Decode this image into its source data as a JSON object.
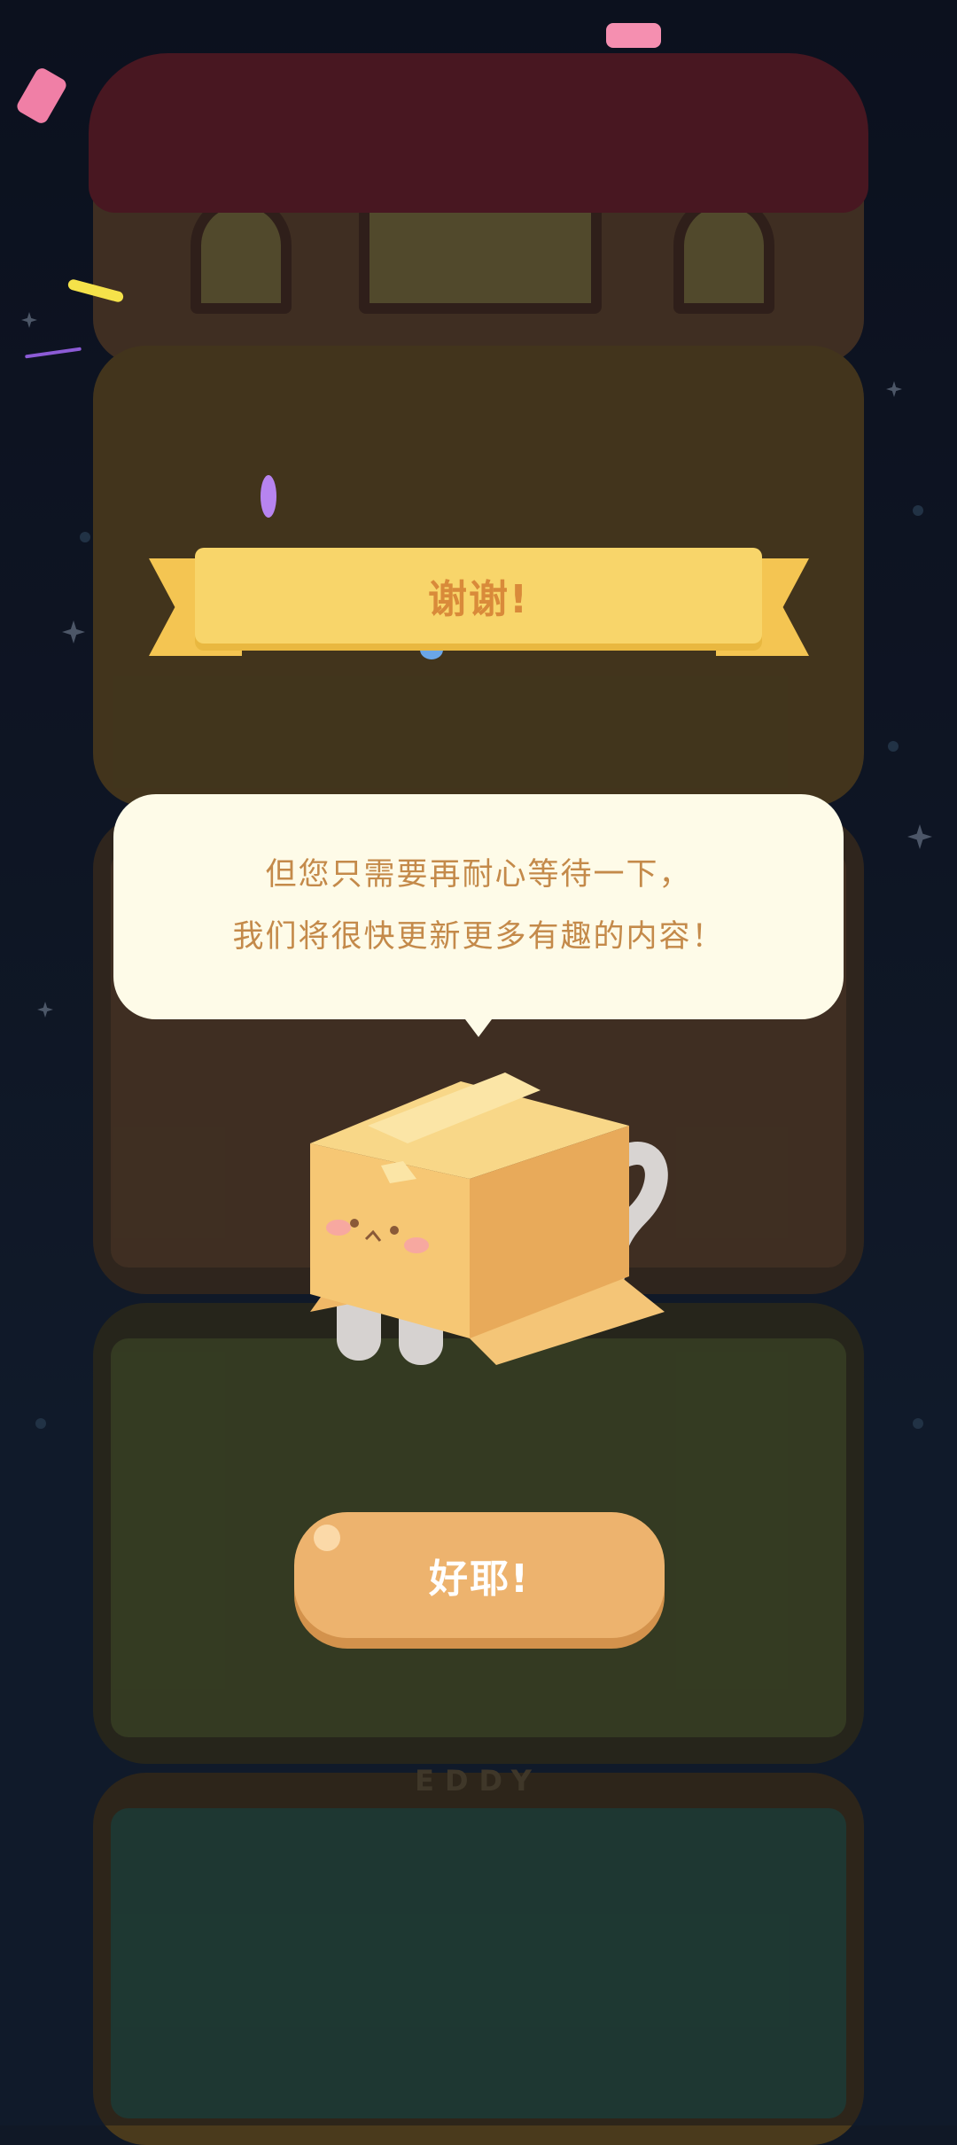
{
  "dialog": {
    "title": "谢谢!",
    "message_line_1": "但您只需要再耐心等待一下，",
    "message_line_2": "我们将很快更新更多有趣的内容！",
    "confirm_label": "好耶!"
  },
  "background": {
    "sign_text": "EDDY"
  },
  "colors": {
    "ribbon": "#f8d56a",
    "ribbon_text": "#d98a3a",
    "bubble": "#fefbe8",
    "bubble_text": "#c48a4a",
    "button": "#edb36e",
    "box": "#f2c57a"
  },
  "icons": {
    "box_cat": "box-cat-illustration",
    "confetti": "confetti-pieces"
  }
}
